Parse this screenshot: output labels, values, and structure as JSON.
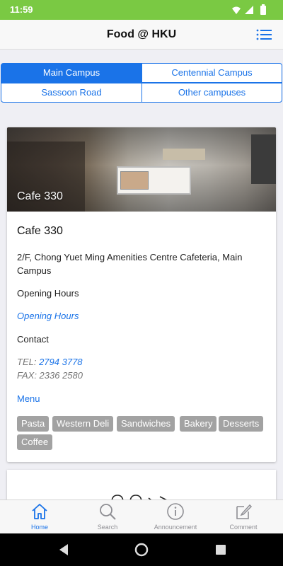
{
  "status_bar": {
    "time": "11:59",
    "color": "#7ac943"
  },
  "header": {
    "title": "Food @ HKU",
    "menu_icon": "list-icon"
  },
  "campus_tabs": [
    {
      "label": "Main Campus",
      "active": true
    },
    {
      "label": "Centennial Campus",
      "active": false
    },
    {
      "label": "Sassoon Road",
      "active": false
    },
    {
      "label": "Other campuses",
      "active": false
    }
  ],
  "restaurant": {
    "image_caption": "Cafe 330",
    "name": "Cafe 330",
    "address": "2/F, Chong Yuet Ming Amenities Centre Cafeteria, Main Campus",
    "hours_label": "Opening Hours",
    "hours_link": "Opening Hours",
    "contact_label": "Contact",
    "tel_prefix": "TEL: ",
    "tel": "2794 3778",
    "fax": "FAX: 2336 2580",
    "menu_link": "Menu",
    "tags": [
      "Pasta",
      "Western Deli",
      "Sandwiches",
      "Bakery",
      "Desserts",
      "Coffee"
    ]
  },
  "tab_bar": [
    {
      "label": "Home",
      "icon": "home-icon",
      "active": true
    },
    {
      "label": "Search",
      "icon": "search-icon",
      "active": false
    },
    {
      "label": "Announcement",
      "icon": "info-icon",
      "active": false
    },
    {
      "label": "Comment",
      "icon": "compose-icon",
      "active": false
    }
  ],
  "colors": {
    "accent": "#1a73e8",
    "tag": "#a2a2a2",
    "inactive_tab": "#8e8e93"
  }
}
